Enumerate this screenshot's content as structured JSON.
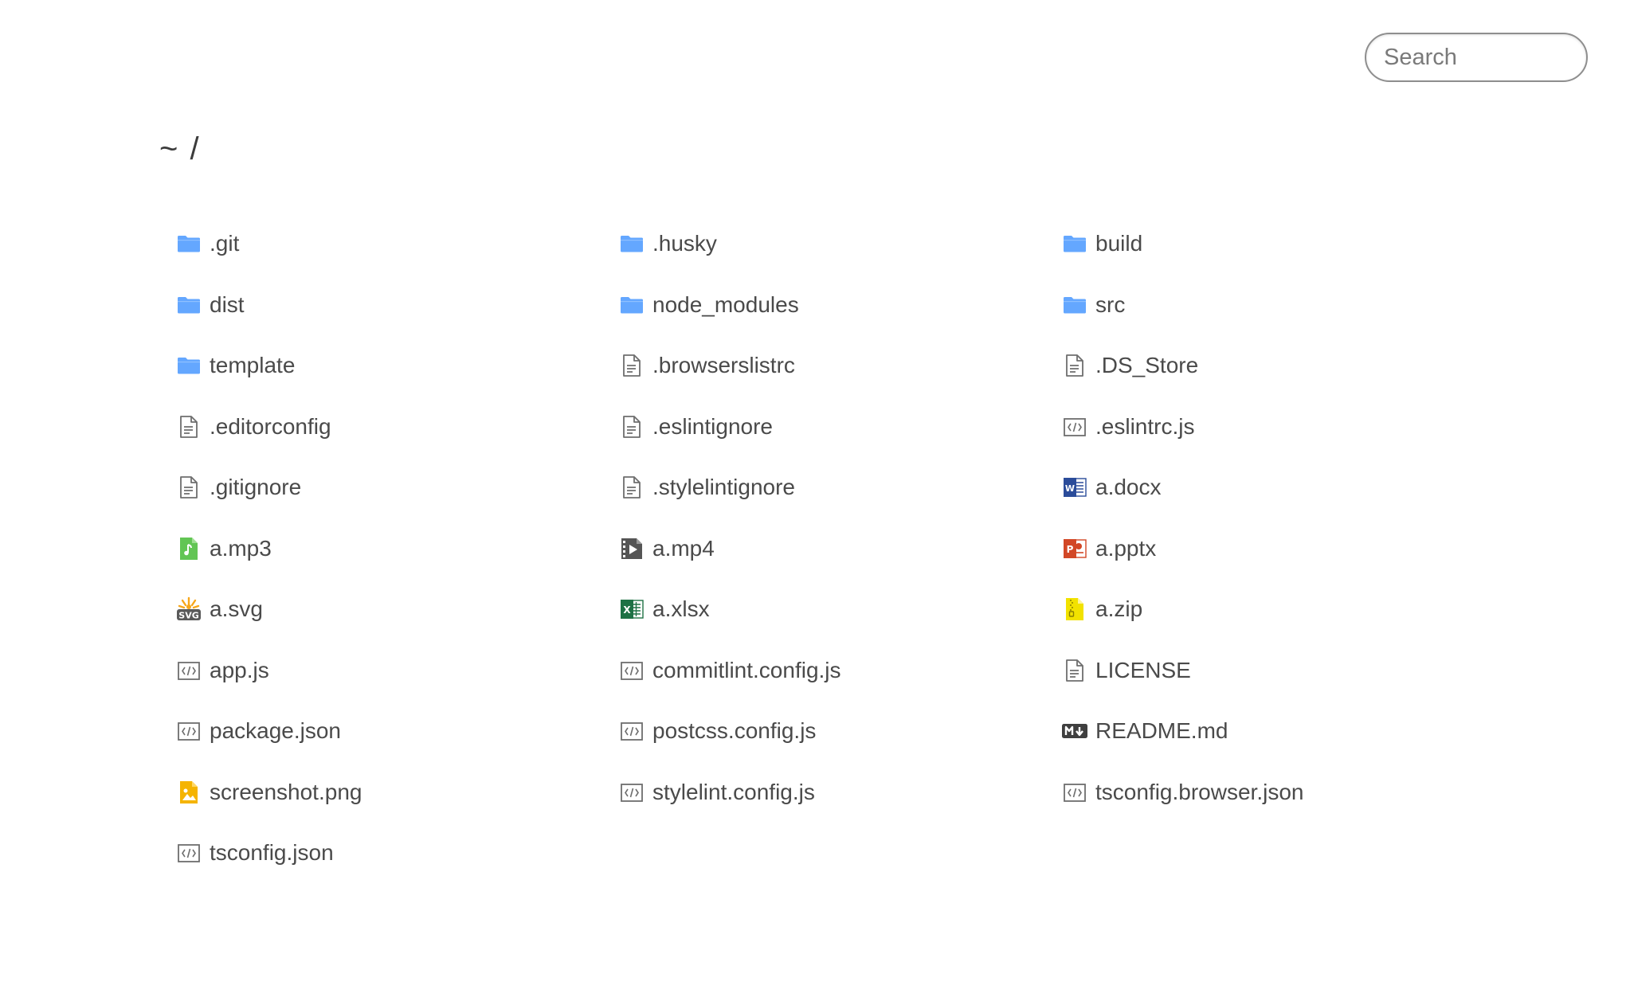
{
  "search": {
    "placeholder": "Search",
    "value": ""
  },
  "breadcrumb": "~ /",
  "files": [
    {
      "name": ".git",
      "icon": "folder"
    },
    {
      "name": ".husky",
      "icon": "folder"
    },
    {
      "name": "build",
      "icon": "folder"
    },
    {
      "name": "dist",
      "icon": "folder"
    },
    {
      "name": "node_modules",
      "icon": "folder"
    },
    {
      "name": "src",
      "icon": "folder"
    },
    {
      "name": "template",
      "icon": "folder"
    },
    {
      "name": ".browserslistrc",
      "icon": "text"
    },
    {
      "name": ".DS_Store",
      "icon": "text"
    },
    {
      "name": ".editorconfig",
      "icon": "text"
    },
    {
      "name": ".eslintignore",
      "icon": "text"
    },
    {
      "name": ".eslintrc.js",
      "icon": "code"
    },
    {
      "name": ".gitignore",
      "icon": "text"
    },
    {
      "name": ".stylelintignore",
      "icon": "text"
    },
    {
      "name": "a.docx",
      "icon": "word"
    },
    {
      "name": "a.mp3",
      "icon": "audio"
    },
    {
      "name": "a.mp4",
      "icon": "video"
    },
    {
      "name": "a.pptx",
      "icon": "powerpoint"
    },
    {
      "name": "a.svg",
      "icon": "svg"
    },
    {
      "name": "a.xlsx",
      "icon": "excel"
    },
    {
      "name": "a.zip",
      "icon": "zip"
    },
    {
      "name": "app.js",
      "icon": "code"
    },
    {
      "name": "commitlint.config.js",
      "icon": "code"
    },
    {
      "name": "LICENSE",
      "icon": "text"
    },
    {
      "name": "package.json",
      "icon": "code"
    },
    {
      "name": "postcss.config.js",
      "icon": "code"
    },
    {
      "name": "README.md",
      "icon": "markdown"
    },
    {
      "name": "screenshot.png",
      "icon": "image"
    },
    {
      "name": "stylelint.config.js",
      "icon": "code"
    },
    {
      "name": "tsconfig.browser.json",
      "icon": "code"
    },
    {
      "name": "tsconfig.json",
      "icon": "code"
    }
  ],
  "colors": {
    "folder": "#64a7ff",
    "audio": "#62c554",
    "word": "#2b4c9a",
    "powerpoint": "#d24726",
    "excel": "#1e7145",
    "zip": "#f2e200",
    "image": "#f5b400",
    "svg": "#f7a71b",
    "icon_gray": "#6e6e6e"
  }
}
